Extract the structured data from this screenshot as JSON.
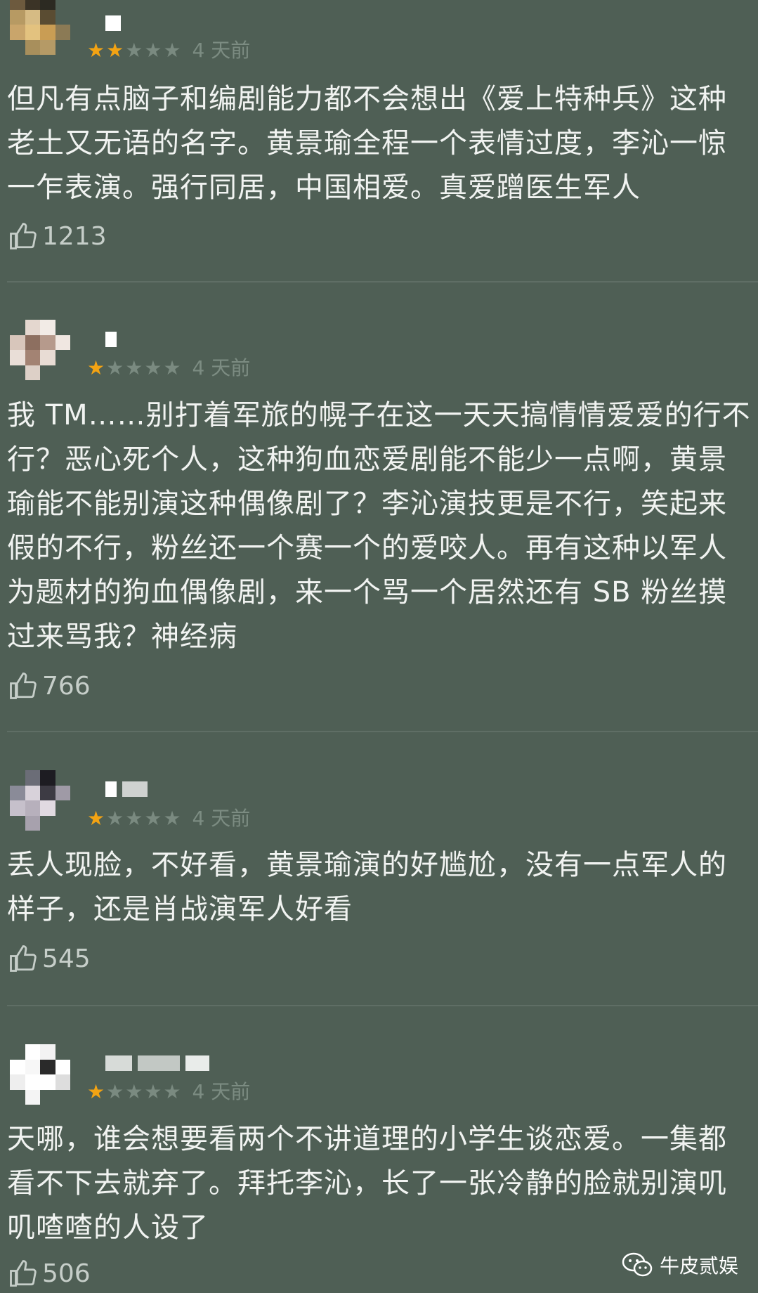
{
  "reviews": [
    {
      "rating": 2,
      "time": "4 天前",
      "text": "但凡有点脑子和编剧能力都不会想出《爱上特种兵》这种老土又无语的名字。黄景瑜全程一个表情过度，李沁一惊一乍表演。强行同居，中国相爱。真爱蹭医生军人",
      "likes": "1213"
    },
    {
      "rating": 1,
      "time": "4 天前",
      "text": "我 TM……别打着军旅的幌子在这一天天搞情情爱爱的行不行？恶心死个人，这种狗血恋爱剧能不能少一点啊，黄景瑜能不能别演这种偶像剧了？李沁演技更是不行，笑起来假的不行，粉丝还一个赛一个的爱咬人。再有这种以军人为题材的狗血偶像剧，来一个骂一个居然还有 SB 粉丝摸过来骂我？神经病",
      "likes": "766"
    },
    {
      "rating": 1,
      "time": "4 天前",
      "text": "丢人现脸，不好看，黄景瑜演的好尴尬，没有一点军人的样子，还是肖战演军人好看",
      "likes": "545"
    },
    {
      "rating": 1,
      "time": "4 天前",
      "text": "天哪，谁会想要看两个不讲道理的小学生谈恋爱。一集都看不下去就弃了。拜托李沁，长了一张冷静的脸就别演叽叽喳喳的人设了",
      "likes": "506"
    }
  ],
  "watermark": {
    "text": "牛皮贰娱",
    "icon": "wechat-icon"
  },
  "colors": {
    "background": "#4f5f55",
    "star_on": "#f3a313",
    "star_off": "#7a8a80",
    "text": "#f1f3f1"
  }
}
